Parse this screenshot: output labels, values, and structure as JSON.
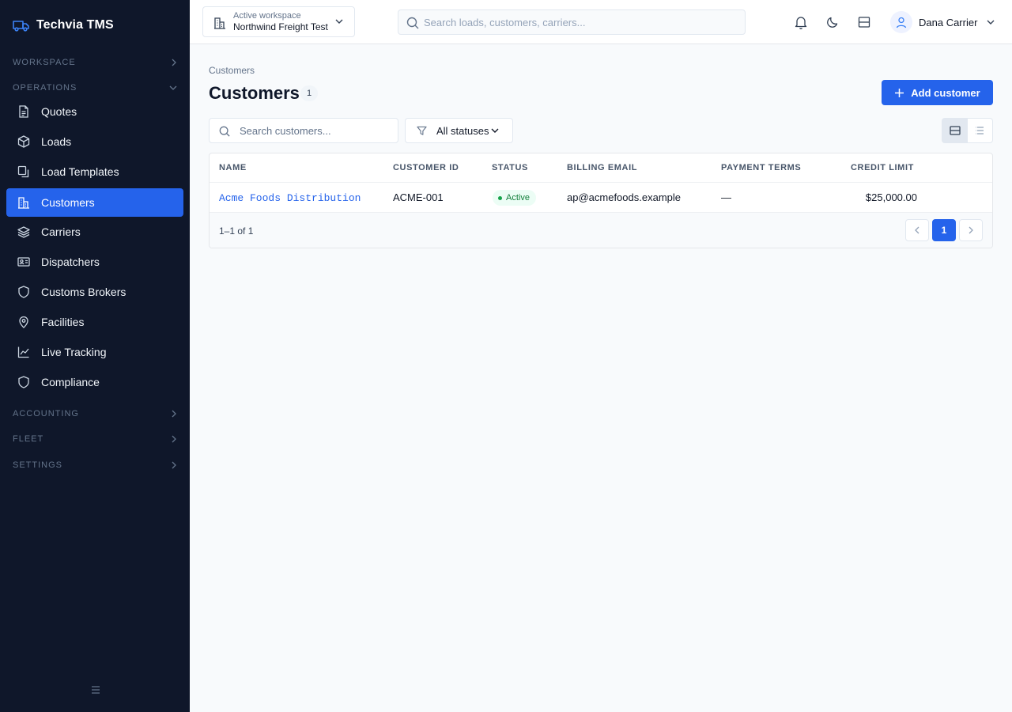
{
  "app": {
    "name": "Techvia TMS"
  },
  "sidebar": {
    "sections": {
      "workspace": "WORKSPACE",
      "operations": "OPERATIONS",
      "accounting": "ACCOUNTING",
      "fleet": "FLEET",
      "settings": "SETTINGS"
    },
    "items": [
      {
        "label": "Quotes",
        "icon": "document-icon"
      },
      {
        "label": "Loads",
        "icon": "box-icon"
      },
      {
        "label": "Load Templates",
        "icon": "copy-icon"
      },
      {
        "label": "Customers",
        "icon": "building-icon",
        "active": true
      },
      {
        "label": "Carriers",
        "icon": "layers-icon"
      },
      {
        "label": "Dispatchers",
        "icon": "id-card-icon"
      },
      {
        "label": "Customs Brokers",
        "icon": "shield-icon"
      },
      {
        "label": "Facilities",
        "icon": "map-pin-icon"
      },
      {
        "label": "Live Tracking",
        "icon": "chart-line-icon"
      },
      {
        "label": "Compliance",
        "icon": "shield-icon"
      }
    ],
    "active_color": "#2563eb",
    "background_color": "#0f172a"
  },
  "topbar": {
    "workspace_label": "Active workspace",
    "workspace_name": "Northwind Freight Test",
    "search_placeholder": "Search loads, customers, carriers...",
    "user_name": "Dana Carrier"
  },
  "page": {
    "breadcrumb": "Customers",
    "title": "Customers",
    "count": "1",
    "add_button": "Add customer",
    "search_placeholder": "Search customers...",
    "status_filter": "All statuses"
  },
  "table": {
    "columns": [
      "NAME",
      "CUSTOMER ID",
      "STATUS",
      "BILLING EMAIL",
      "PAYMENT TERMS",
      "CREDIT LIMIT"
    ],
    "rows": [
      {
        "name": "Acme Foods Distribution",
        "customer_id": "ACME-001",
        "status": "Active",
        "billing_email": "ap@acmefoods.example",
        "payment_terms": "—",
        "credit_limit": "$25,000.00"
      }
    ],
    "range": "1–1 of 1",
    "current_page": "1",
    "status_active_color": "#16a34a"
  }
}
